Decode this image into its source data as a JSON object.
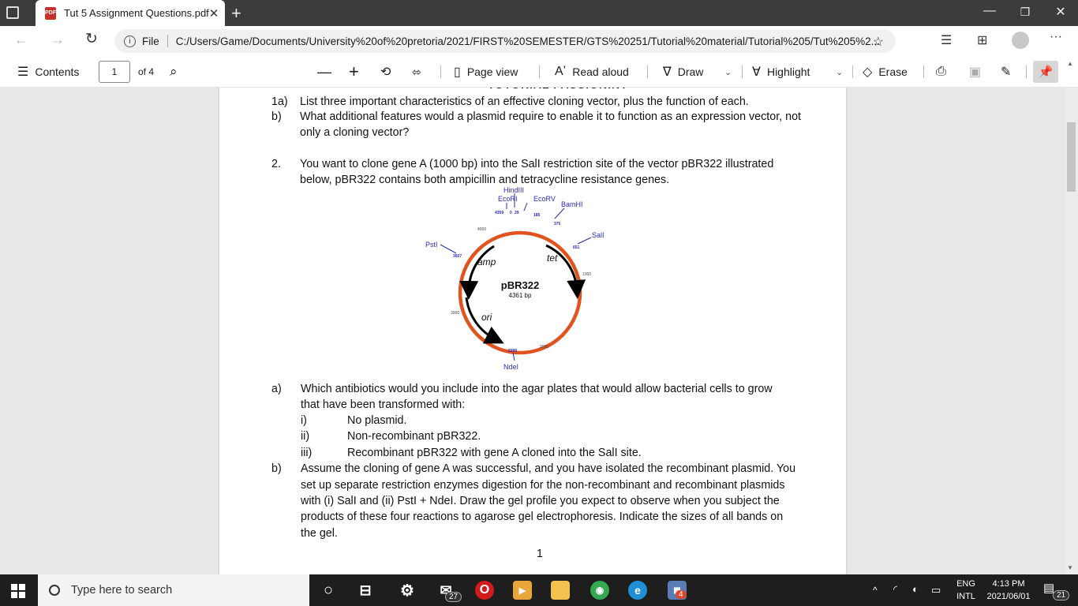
{
  "browser": {
    "tab_title": "Tut 5 Assignment Questions.pdf",
    "tab_icon_text": "PDF",
    "address_prefix": "File",
    "url": "C:/Users/Game/Documents/University%20of%20pretoria/2021/FIRST%20SEMESTER/GTS%20251/Tutorial%20material/Tutorial%205/Tut%205%2..."
  },
  "pdf_toolbar": {
    "contents_label": "Contents",
    "page_number": "1",
    "page_count": "of 4",
    "page_view_label": "Page view",
    "read_aloud_label": "Read aloud",
    "draw_label": "Draw",
    "highlight_label": "Highlight",
    "erase_label": "Erase"
  },
  "document": {
    "q1a_num": "1a)",
    "q1a": "List three important characteristics of an effective cloning vector, plus the function of each.",
    "q1b_num": "b)",
    "q1b_line1": "What additional features would a plasmid require to enable it to function as an expression vector, not",
    "q1b_line2": "only a cloning vector?",
    "q2_num": "2.",
    "q2_line1": "You want to clone gene A (1000 bp) into the SalI restriction site of the vector pBR322 illustrated",
    "q2_line2": "below, pBR322 contains both ampicillin and tetracycline resistance genes.",
    "qa_num": "a)",
    "qa_line1": "Which antibiotics would you include into the agar plates that would allow bacterial cells to grow",
    "qa_line2": "that have been transformed with:",
    "qa_i_num": "i)",
    "qa_i": "No plasmid.",
    "qa_ii_num": "ii)",
    "qa_ii": "Non-recombinant pBR322.",
    "qa_iii_num": "iii)",
    "qa_iii": "Recombinant pBR322 with gene A cloned into the SalI site.",
    "qb_num": "b)",
    "qb_line1": "Assume the cloning of gene A was successful, and you have isolated the recombinant plasmid. You",
    "qb_line2": "set up separate restriction enzymes digestion for the non-recombinant and recombinant plasmids",
    "qb_line3": "with (i) SalI and (ii)  PstI + NdeI. Draw the gel profile you expect to observe when you subject the",
    "qb_line4": "products of these four reactions to agarose gel electrophoresis. Indicate the sizes of all bands on",
    "qb_line5": "the gel.",
    "page_footer_number": "1"
  },
  "plasmid": {
    "name": "pBR322",
    "size": "4361 bp",
    "sites": {
      "hindiii": "HindIII",
      "ecori": "EcoRI",
      "ecorv": "EcoRV",
      "bamhi": "BamHI",
      "sali": "SalI",
      "psti": "PstI",
      "ndei": "NdeI"
    },
    "positions": {
      "p4359": "4359",
      "p0": "0",
      "p29": "29",
      "p185": "185",
      "p375": "375",
      "p651": "651",
      "p3607": "3607",
      "p2295": "2295"
    },
    "scale": {
      "s4000": "4000",
      "s1000": "1000",
      "s3000": "3000",
      "s2000": "2000"
    },
    "genes": {
      "amp": "amp",
      "tet": "tet",
      "ori": "ori"
    },
    "ring_color": "#e0531f",
    "label_color": "#2a2ab8"
  },
  "taskbar": {
    "search_placeholder": "Type here to search",
    "mail_badge": "27",
    "app_badge": "4",
    "lang_top": "ENG",
    "lang_bottom": "INTL",
    "time": "4:13 PM",
    "date": "2021/06/01",
    "notification_count": "21"
  }
}
